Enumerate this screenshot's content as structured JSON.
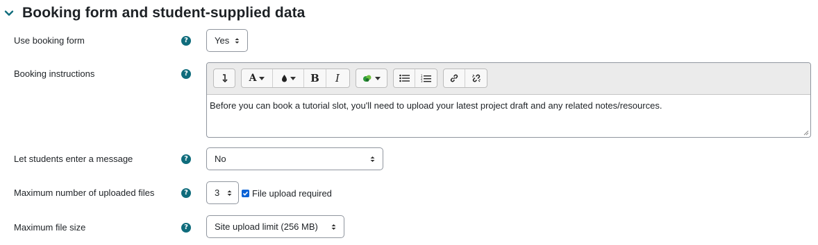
{
  "section": {
    "title": "Booking form and student-supplied data",
    "expanded_icon": "chevron-down-icon"
  },
  "fields": {
    "use_booking_form": {
      "label": "Use booking form",
      "value": "Yes"
    },
    "booking_instructions": {
      "label": "Booking instructions",
      "content": "Before you can book a tutorial slot, you'll need to upload your latest project draft and any related notes/resources."
    },
    "let_students_message": {
      "label": "Let students enter a message",
      "value": "No"
    },
    "max_uploaded_files": {
      "label": "Maximum number of uploaded files",
      "value": "3",
      "file_upload_required_label": "File upload required",
      "file_upload_required": true
    },
    "max_file_size": {
      "label": "Maximum file size",
      "value": "Site upload limit (256 MB)"
    }
  },
  "help_icon": "question-circle-icon",
  "editor_toolbar": {
    "buttons": [
      "collapse-toolbar",
      "font-style",
      "font-color",
      "bold",
      "italic",
      "media-insert",
      "unordered-list",
      "ordered-list",
      "link",
      "unlink"
    ],
    "bold_glyph": "B",
    "italic_glyph": "I",
    "font_glyph": "A"
  },
  "colors": {
    "help_icon": "#0f6c7c",
    "checkbox": "#0b63d6",
    "text": "#1d2125"
  }
}
